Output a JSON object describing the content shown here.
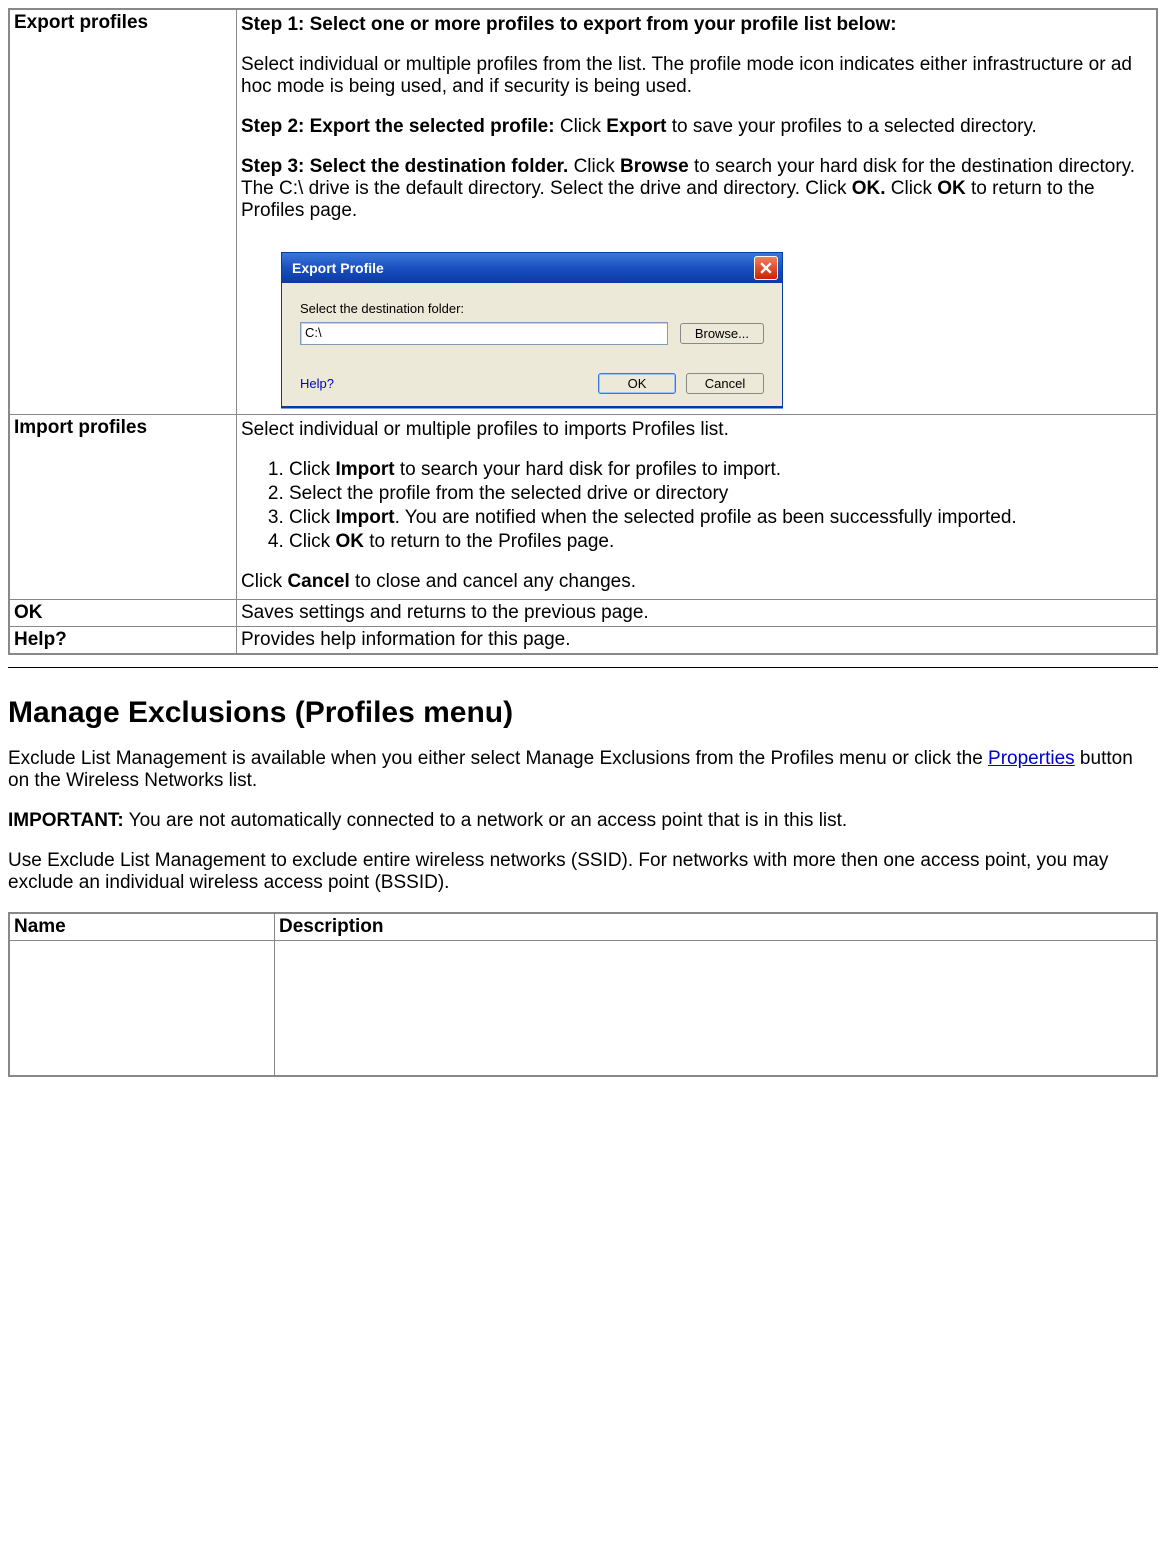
{
  "rows": {
    "export": {
      "label": "Export profiles",
      "step1_label": "Step 1: Select one or more profiles to export from your profile list below:",
      "step1_body": "Select individual or multiple profiles from the list. The profile mode icon indicates either infrastructure or ad hoc mode is being used, and if security is being used.",
      "step2_label": "Step 2: Export the selected profile: ",
      "step2_click": "Click ",
      "step2_export": "Export",
      "step2_rest": " to save your profiles to a selected directory.",
      "step3_label": "Step 3: Select the destination folder. ",
      "step3_click1": "Click ",
      "step3_browse": "Browse",
      "step3_mid": " to search your hard disk for the destination directory. The C:\\ drive is the default directory. Select the drive and directory. Click ",
      "step3_ok1": "OK.",
      "step3_click2": " Click ",
      "step3_ok2": "OK",
      "step3_rest": " to return to the Profiles page."
    },
    "import": {
      "label": "Import profiles",
      "intro": "Select individual or multiple profiles to imports Profiles list.",
      "li1_a": "Click ",
      "li1_b": "Import",
      "li1_c": " to search your hard disk for profiles to import.",
      "li2": "Select the profile from the selected drive or directory",
      "li3_a": "Click ",
      "li3_b": "Import",
      "li3_c": ". You are notified when the selected profile as been successfully imported.",
      "li4_a": "Click ",
      "li4_b": "OK",
      "li4_c": " to return to the Profiles page.",
      "tail_a": "Click ",
      "tail_b": "Cancel",
      "tail_c": " to close and cancel any changes."
    },
    "ok": {
      "label": "OK",
      "desc": "Saves settings and returns to the previous page."
    },
    "help": {
      "label": "Help?",
      "desc": "Provides help information for this page."
    }
  },
  "dialog": {
    "title": "Export Profile",
    "select_label": "Select the destination folder:",
    "path": "C:\\",
    "browse": "Browse...",
    "help": "Help?",
    "ok": "OK",
    "cancel": "Cancel"
  },
  "section": {
    "heading": "Manage Exclusions (Profiles menu)",
    "p1_a": "Exclude List Management is available when you either select Manage Exclusions from the Profiles menu or click the ",
    "p1_link": "Properties",
    "p1_b": " button on the Wireless Networks list.",
    "p2_label": "IMPORTANT:",
    "p2_body": " You are not automatically connected to a network or an access point that is in this list.",
    "p3": "Use Exclude List Management to exclude entire wireless networks (SSID). For networks with more then one access point, you may exclude an individual wireless access point (BSSID)."
  },
  "excl_table": {
    "name": "Name",
    "desc": "Description"
  }
}
